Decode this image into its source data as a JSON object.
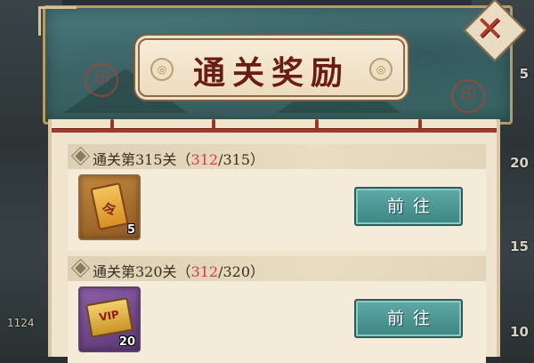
{
  "dialog": {
    "title": "通关奖励",
    "close_label": "✕"
  },
  "rewards": [
    {
      "label_prefix": "通关第315关（",
      "current": "312",
      "total": "/315）",
      "item_count": "5",
      "item_icon": "war-token-icon",
      "button_label": "前往"
    },
    {
      "label_prefix": "通关第320关（",
      "current": "312",
      "total": "/320）",
      "item_count": "20",
      "item_icon": "vip-card-icon",
      "button_label": "前往"
    }
  ],
  "background": {
    "right_numbers": [
      "5",
      "20",
      "15",
      "10"
    ],
    "left_number": "1124"
  },
  "colors": {
    "accent_red": "#d83d3d",
    "button_teal": "#4c9996",
    "header_teal": "#3d6b6e",
    "title_text": "#6a1c12"
  }
}
